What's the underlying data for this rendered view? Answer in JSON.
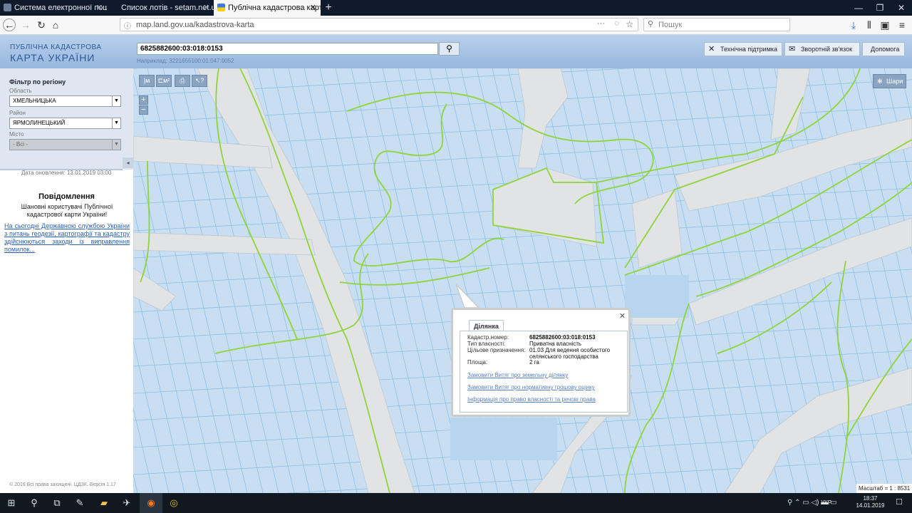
{
  "browser": {
    "tabs": [
      {
        "label": "Система електронної пошти"
      },
      {
        "label": "Список лотів - setam.net.ua"
      },
      {
        "label": "Публічна кадастрова карта Ук"
      }
    ],
    "url": "map.land.gov.ua/kadastrova-karta",
    "search_placeholder": "Пошук"
  },
  "header": {
    "logo_line1": "ПУБЛІЧНА КАДАСТРОВА",
    "logo_line2": "КАРТА УКРАЇНИ",
    "cadastre_query": "6825882600:03:018:0153",
    "example": "Наприклад: 3221655100:01:047:0052",
    "buttons": [
      {
        "label": "Технічна підтримка",
        "icon": "wrench-icon"
      },
      {
        "label": "Зворотній зв'язок",
        "icon": "mail-icon"
      },
      {
        "label": "Допомога"
      }
    ]
  },
  "sidebar": {
    "filter_title": "Фільтр по регіону",
    "oblast_label": "Область",
    "oblast_value": "ХМЕЛЬНИЦЬКА",
    "rayon_label": "Район",
    "rayon_value": "ЯРМОЛИНЕЦЬКИЙ",
    "city_label": "Місто",
    "city_value": "- Всі -",
    "updated": "Дата оновлення: 13.01.2019 03:00",
    "notice_title": "Повідомлення",
    "notice_text": "Шановні користувачі Публічної кадастрової карти України!",
    "notice_link": "На сьогодні Державною службою України з питань геодезії, картографії та кадастру здійснюються заходи із виправлення помилок...",
    "copyright": "© 2016 Всі права захищені. ЦДЗК. Версія 1.17"
  },
  "map": {
    "layers_label": "Шари",
    "scale_label": "Масштаб = 1 : 8531",
    "tools": [
      "м",
      "м²",
      "print",
      "?"
    ],
    "popup": {
      "tab": "Ділянка",
      "fields": [
        {
          "key": "Кадастр.номер:",
          "value": "6825882600:03:018:0153"
        },
        {
          "key": "Тип власності:",
          "value": "Приватна власність"
        },
        {
          "key": "Цільове призначення:",
          "value": "01.03 Для ведення особистого селянського господарства"
        },
        {
          "key": "Площа:",
          "value": "2 га"
        }
      ],
      "links": [
        "Замовити Витяг про земельну ділянку",
        "Замовити Витяг про нормативну грошову оцінку",
        "Інформація про право власності та речові права"
      ]
    }
  },
  "taskbar": {
    "lang": "УКР",
    "time": "18:37",
    "date": "14.01.2019"
  },
  "colors": {
    "parcel_fill": "#c9def0",
    "parcel_line": "#7fb6e0",
    "boundary": "#8fd43a",
    "road": "#e2e2e2"
  }
}
